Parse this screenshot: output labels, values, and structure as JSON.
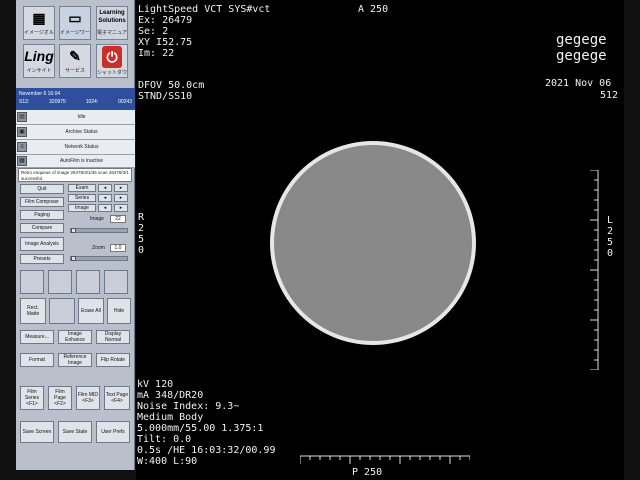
{
  "app": {
    "launcher": [
      {
        "icon": "image-tool-icon",
        "caption": "イメージオルガ",
        "glyph": "▦"
      },
      {
        "icon": "monitor-icon",
        "caption": "イメージワークス",
        "glyph": "▭"
      },
      {
        "icon": "learning-solutions-icon",
        "caption": "電子マニュアル",
        "glyph": "Learning Solutions"
      },
      {
        "icon": "ling-icon",
        "caption": "インサイト",
        "glyph": "Ling"
      },
      {
        "icon": "service-icon",
        "caption": "サービス",
        "glyph": "✎"
      },
      {
        "icon": "power-icon",
        "caption": "シャットダウン",
        "glyph": "⏻"
      }
    ],
    "status_bar": {
      "date": "November 6 16:04",
      "s_label": "S12:",
      "s_value": "320975",
      "t_label": "1024:",
      "t_value": "00243"
    },
    "status_rows": [
      "Idle",
      "Archive Status",
      "Network Status",
      "AutoFilm is inactive"
    ],
    "message": "Retro enqueue of image 26478/3/1/45 scan 26478/3/1 successful."
  },
  "controls": {
    "quit": "Quit",
    "film_composer": "Film Composer",
    "paging": "Paging",
    "compare": "Compare",
    "image_analysis": "Image Analysis",
    "presets": "Presets",
    "exam": "Exam",
    "series": "Series",
    "image": "Image",
    "image_field_label": "Image",
    "image_field_value": "22",
    "zoom_label": "Zoom",
    "zoom_value": "1.0",
    "rect_matte": "Rect. Matte",
    "erase_all": "Erase All",
    "hide": "Hide",
    "measure": "Measure...",
    "image_enhance": "Image Enhance",
    "display_normal": "Display Normal",
    "format": "Format",
    "reference_image": "Reference Image",
    "flip_rotate": "Flip Rotate",
    "film_series": "Film Series <F1>",
    "film_page": "Film Page <F2>",
    "film_mid": "Film MID <F3>",
    "text_page": "Text Page <F4>",
    "save_screen": "Save Screen",
    "save_state": "Save State",
    "user_prefs": "User Prefs"
  },
  "viewer": {
    "top_left": "LightSpeed VCT SYS#vct\nEx: 26479\nSe: 2\nXY I52.75\nIm: 22",
    "top_center": "A 250",
    "patient1": "gegege",
    "patient2": "gegege",
    "dfov": "DFOV 50.0cm\nSTND/SS10",
    "date": "2021 Nov 06",
    "matrix": "512",
    "left_orient": "R\n2\n5\n0",
    "right_orient": "L\n2\n5\n0",
    "bottom_center": "P 250",
    "scan_params": "kV 120\nmA 348/DR20\nNoise Index: 9.3~\nMedium Body\n5.000mm/55.00 1.375:1\nTilt: 0.0\n0.5s /HE 16:03:32/00.99\nW:400 L:90"
  }
}
